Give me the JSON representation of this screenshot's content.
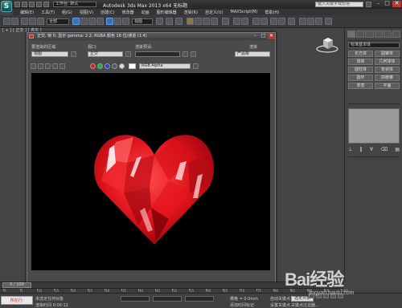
{
  "window": {
    "title": "Autodesk 3ds Max  2013 x64   无标题",
    "app_logo": "S",
    "workspace_combo": "工作台: 默认",
    "search_placeholder": "键入关键字或短语",
    "min": "–",
    "max": "□",
    "close": "✕"
  },
  "menu": [
    "编辑(E)",
    "工具(T)",
    "组(G)",
    "视图(V)",
    "创建(C)",
    "修改器",
    "动画",
    "图形编辑器",
    "渲染(R)",
    "自定义(U)",
    "MAXScript(M)",
    "帮助(H)"
  ],
  "toolbar": {
    "selection_combo": "全部",
    "view_combo": "视图"
  },
  "viewport": {
    "label": "[ + ] [ 正交 ] [ 真实 ]"
  },
  "command_panel": {
    "object_type_combo": "标准基本体",
    "buttons": [
      "长方体",
      "圆锥体",
      "球体",
      "几何球体",
      "圆柱体",
      "管状体",
      "圆环",
      "四棱锥",
      "茶壶",
      "平面"
    ]
  },
  "render_frame": {
    "title": "正交, 帧 0, 显示 gamma: 2.2, RGBA 颜色 16 位/通道 (1:4)",
    "area_label": "要渲染的区域:",
    "area_value": "视图",
    "viewport_label": "视口:",
    "viewport_value": "正交",
    "preset_label": "渲染预设:",
    "preset_value": "",
    "render_label": "渲染",
    "render_value": "产品级",
    "channel_value": "RGB Alpha",
    "close": "✕",
    "min": "–",
    "max": "□"
  },
  "timeline": {
    "frame_counter": "0 / 100",
    "ticks": [
      "0",
      "5",
      "10",
      "15",
      "20",
      "25",
      "30",
      "35",
      "40",
      "45",
      "50",
      "55",
      "60",
      "65",
      "70",
      "75",
      "80",
      "85",
      "90",
      "95",
      "100"
    ]
  },
  "status": {
    "red_label": "所在行:",
    "message1": "未选定任何对象",
    "message2": "渲染时间 0:00:12",
    "grid_text": "栅格 = 0.0mm",
    "auto_key_label": "自动关键点",
    "selected_object": "选定对象",
    "set_key_label": "设置关键点",
    "key_filter_label": "关键点过滤器...",
    "add_time_tag": "添加时间标记"
  },
  "watermark": {
    "brand": "Bai经验",
    "url": "jingyan.baidu.com"
  },
  "colors": {
    "heart": "#e0141c",
    "render_bg": "#000000",
    "close_red": "#b83a30"
  }
}
